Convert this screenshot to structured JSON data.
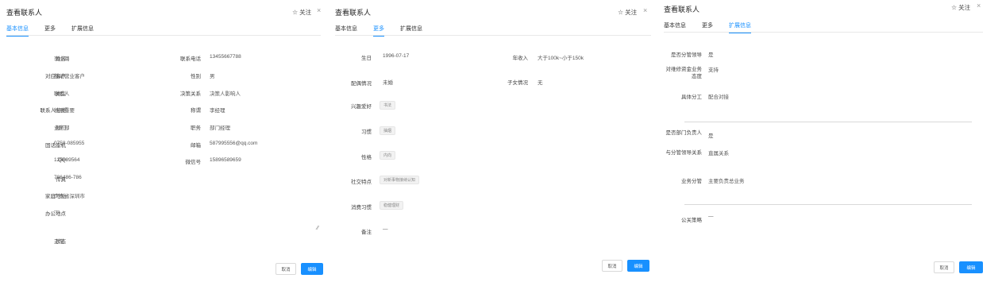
{
  "panel1": {
    "title": "查看联系人",
    "follow": "关注",
    "close": "×",
    "tabs": [
      "基本信息",
      "更多",
      "扩展信息"
    ],
    "left_fields": [
      {
        "label": "姓名",
        "value": "李小璐"
      },
      {
        "label": "对应客户",
        "value": "移动营业客户"
      },
      {
        "label": "类型",
        "value": "联系人"
      },
      {
        "label": "联系人分类",
        "value": "特别重要"
      },
      {
        "label": "部门",
        "value": "业务部"
      },
      {
        "label": "固话座机",
        "value": "0758-085955"
      },
      {
        "label": "QQ",
        "value": "125689564"
      },
      {
        "label": "传真",
        "value": "786486-786"
      },
      {
        "label": "家庭地址",
        "value": "广东省深圳市"
      },
      {
        "label": "办公地点",
        "value": "—"
      }
    ],
    "right_fields": [
      {
        "label": "联系电话",
        "value": "13455667788"
      },
      {
        "label": "性别",
        "value": "男"
      },
      {
        "label": "决策关系",
        "value": "决策人影响人"
      },
      {
        "label": "称谓",
        "value": "李经理"
      },
      {
        "label": "职务",
        "value": "部门经理"
      },
      {
        "label": "邮箱",
        "value": "587995556@qq.com"
      },
      {
        "label": "微信号",
        "value": "15896589659"
      }
    ],
    "status": {
      "label": "状态",
      "value": "正常"
    },
    "cancel": "取消",
    "edit": "编辑"
  },
  "panel2": {
    "title": "查看联系人",
    "follow": "关注",
    "close": "×",
    "tabs": [
      "基本信息",
      "更多",
      "扩展信息"
    ],
    "birthday": {
      "label": "生日",
      "value": "1996-07-17"
    },
    "income": {
      "label": "年收入",
      "value": "大于100k~小于150k"
    },
    "spouse": {
      "label": "配偶情况",
      "value": "未婚"
    },
    "children": {
      "label": "子女情况",
      "value": "无"
    },
    "tag_fields": [
      {
        "label": "兴趣爱好",
        "tag": "书法"
      },
      {
        "label": "习惯",
        "tag": "抽烟"
      },
      {
        "label": "性格",
        "tag": "内向"
      },
      {
        "label": "社交特点",
        "tag": "对新事物接纳认知"
      },
      {
        "label": "消费习惯",
        "tag": "稳健理财"
      }
    ],
    "note": {
      "label": "备注",
      "value": "—"
    },
    "cancel": "取消",
    "edit": "编辑"
  },
  "panel3": {
    "title": "查看联系人",
    "follow": "关注",
    "close": "×",
    "tabs": [
      "基本信息",
      "更多",
      "扩展信息"
    ],
    "fields": [
      {
        "label": "是否分管领导",
        "value": "是"
      },
      {
        "label": "对维修资金业务态度",
        "value": "支持"
      },
      {
        "label": "具体分工",
        "value": "配合对接"
      },
      {
        "label": "是否部门负责人",
        "value": "是"
      },
      {
        "label": "与分管领导关系",
        "value": "直属关系"
      },
      {
        "label": "业务分管",
        "value": "主要负责总业务"
      },
      {
        "label": "公关策略",
        "value": "—"
      }
    ],
    "cancel": "取消",
    "edit": "编辑"
  },
  "colors": {
    "accent": "#1890ff",
    "text": "#333333",
    "muted": "#888888",
    "border": "#e8e8e8"
  }
}
